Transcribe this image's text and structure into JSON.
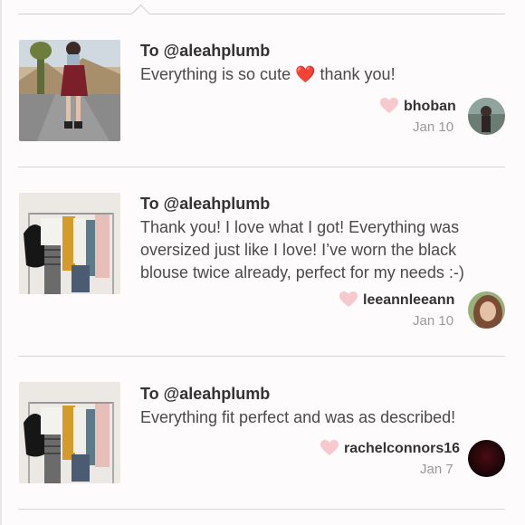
{
  "reviews": [
    {
      "to": "To @aleahplumb",
      "message_before": "Everything is so cute ",
      "emoji": "❤️",
      "message_after": " thank you!",
      "username": "bhoban",
      "date": "Jan 10",
      "photo": "outfit-photo-street",
      "avatar_colors": [
        "#6a7d74",
        "#3b2e2c"
      ]
    },
    {
      "to": "To @aleahplumb",
      "message": "Thank you! I love what I got! Everything was oversized just like I love! I’ve worn the black blouse twice already, perfect for my needs :-)",
      "username": "leeannleeann",
      "date": "Jan 10",
      "photo": "clothing-rack-photo",
      "avatar_colors": [
        "#9ab07a",
        "#7a4b35"
      ]
    },
    {
      "to": "To @aleahplumb",
      "message": "Everything fit perfect and was as described!",
      "username": "rachelconnors16",
      "date": "Jan 7",
      "photo": "clothing-rack-photo",
      "avatar_colors": [
        "#4a0d12",
        "#120406"
      ]
    }
  ],
  "colors": {
    "heart": "#f6c9cf",
    "emoji_heart": "#e0202a",
    "divider": "#d7d7d7"
  }
}
